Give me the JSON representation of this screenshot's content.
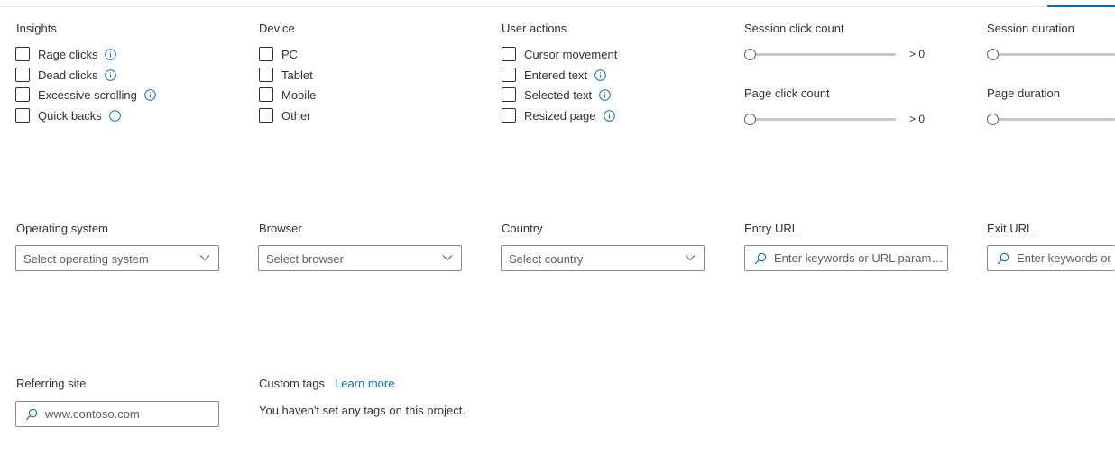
{
  "insights": {
    "title": "Insights",
    "items": [
      {
        "label": "Rage clicks",
        "info": true
      },
      {
        "label": "Dead clicks",
        "info": true
      },
      {
        "label": "Excessive scrolling",
        "info": true
      },
      {
        "label": "Quick backs",
        "info": true
      }
    ]
  },
  "device": {
    "title": "Device",
    "items": [
      {
        "label": "PC"
      },
      {
        "label": "Tablet"
      },
      {
        "label": "Mobile"
      },
      {
        "label": "Other"
      }
    ]
  },
  "user_actions": {
    "title": "User actions",
    "items": [
      {
        "label": "Cursor movement",
        "info": false
      },
      {
        "label": "Entered text",
        "info": true
      },
      {
        "label": "Selected text",
        "info": true
      },
      {
        "label": "Resized page",
        "info": true
      }
    ]
  },
  "session_click_count": {
    "title": "Session click count",
    "value_label": "> 0",
    "level": 0
  },
  "page_click_count": {
    "title": "Page click count",
    "value_label": "> 0",
    "level": 0
  },
  "session_duration": {
    "title": "Session duration",
    "level": 0
  },
  "page_duration": {
    "title": "Page duration",
    "level": 0
  },
  "operating_system": {
    "title": "Operating system",
    "placeholder": "Select operating system"
  },
  "browser": {
    "title": "Browser",
    "placeholder": "Select browser"
  },
  "country": {
    "title": "Country",
    "placeholder": "Select country"
  },
  "entry_url": {
    "title": "Entry URL",
    "placeholder": "Enter keywords or URL parameters"
  },
  "exit_url": {
    "title": "Exit URL",
    "placeholder": "Enter keywords or URL parameters"
  },
  "referring_site": {
    "title": "Referring site",
    "placeholder": "www.contoso.com"
  },
  "custom_tags": {
    "title": "Custom tags",
    "learn_more": "Learn more",
    "empty_message": "You haven't set any tags on this project."
  },
  "colors": {
    "accent": "#0f6cbd",
    "border": "#8a8886",
    "text": "#323130"
  }
}
